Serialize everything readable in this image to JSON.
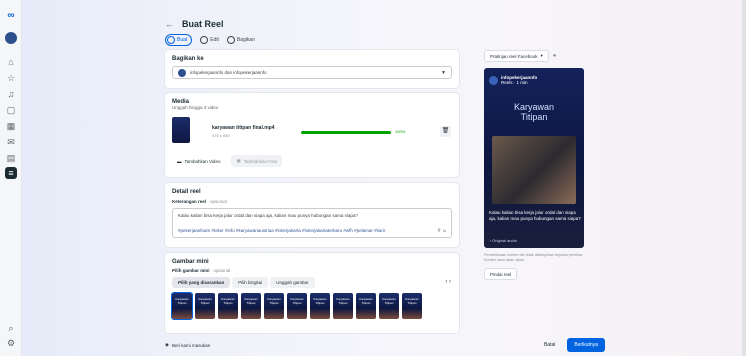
{
  "header": {
    "back_label": "←",
    "title": "Buat Reel"
  },
  "steps": [
    {
      "label": "Buat"
    },
    {
      "label": "Edit"
    },
    {
      "label": "Bagikan"
    }
  ],
  "share": {
    "title": "Bagikan ke",
    "selected": "infopekerjaannfo dan infopekerjaannfo"
  },
  "media": {
    "title": "Media",
    "subtitle": "Unggah hingga 3 video",
    "file_name": "karyawan titipan final.mp4",
    "file_size": "476 x 850",
    "progress": 100,
    "progress_label": "100%",
    "add_video": "Tambahkan Video",
    "add_photo": "Tambahkan Foto"
  },
  "details": {
    "title": "Detail reel",
    "caption_label": "Keterangan reel",
    "optional": "· opsional",
    "caption_text": "Kalau kalian bisa kerja jalur ordal dan siapa aja, kalian mau punya hubungan sama siapa?",
    "hashtags": "#pekerjaanfoam #loker #info #karyawanaustriaa #lokerjakarta #lokerjakartaterbaru #wfh #pelamar #karir"
  },
  "thumbnail": {
    "title": "Gambar mini",
    "label": "Pilih gambar mini",
    "optional": "· opsional",
    "tabs": [
      "Pilih yang disarankan",
      "Pilih bingkai",
      "Unggah gambar"
    ],
    "tile_text": "Karyawan Titipan"
  },
  "preview": {
    "dropdown": "Pratinjau reel Facebook",
    "page_name": "infopekerjaannfo",
    "page_meta": "Reels · 1 min",
    "title_line1": "Karyawan",
    "title_line2": "Titipan",
    "caption": "Kalau kalian bisa kerja jalur ordal dan siapa aja, kalian mau punya hubungan sama siapa?",
    "audio": "Original audio",
    "note": "Pemeriksaan konten tsb tidak ditampilkan kepada pemirsa. Konten kami akan dicek",
    "reel_btn": "Pindai reel"
  },
  "footer": {
    "feedback": "Beri kami masukan",
    "back": "Batal",
    "next": "Berikutnya"
  },
  "rail_icons": [
    "meta-logo",
    "avatar-icon",
    "home-icon",
    "star-icon",
    "bell-icon",
    "calendar-icon",
    "grid-icon",
    "chat-icon",
    "chart-icon",
    "reels-icon",
    "search-icon",
    "gear-icon",
    "help-icon"
  ]
}
